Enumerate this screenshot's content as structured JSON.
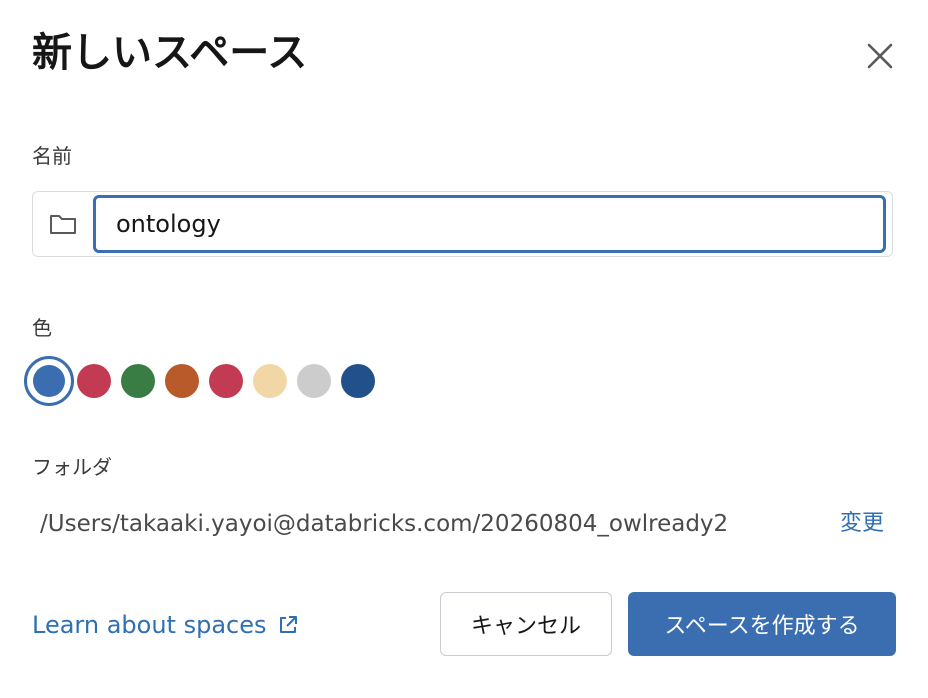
{
  "dialog": {
    "title": "新しいスペース",
    "close_icon": "close-icon"
  },
  "name_field": {
    "label": "名前",
    "value": "ontology",
    "icon": "folder-icon"
  },
  "color_field": {
    "label": "色",
    "selected_index": 0,
    "swatches": [
      "#3a6eb0",
      "#c23b52",
      "#3a7d44",
      "#b85a2a",
      "#c23b52",
      "#f2d7a6",
      "#cccccc",
      "#22508a"
    ]
  },
  "folder_field": {
    "label": "フォルダ",
    "path": "/Users/takaaki.yayoi@databricks.com/20260804_owlready2",
    "change_label": "変更"
  },
  "footer": {
    "learn_link": "Learn about spaces",
    "learn_icon": "external-link-icon",
    "cancel_label": "キャンセル",
    "create_label": "スペースを作成する"
  },
  "colors": {
    "primary": "#3a6eb0",
    "link": "#2f6fb3"
  }
}
